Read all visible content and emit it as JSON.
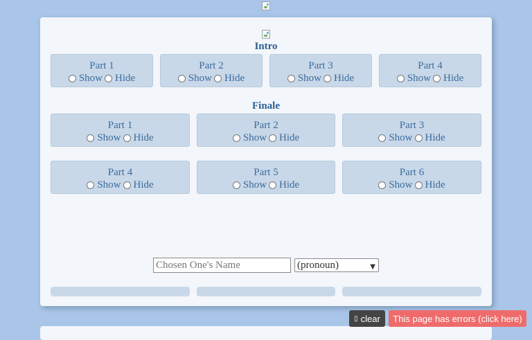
{
  "intro": {
    "title": "Intro",
    "parts": [
      {
        "label": "Part 1",
        "show": "Show",
        "hide": "Hide"
      },
      {
        "label": "Part 2",
        "show": "Show",
        "hide": "Hide"
      },
      {
        "label": "Part 3",
        "show": "Show",
        "hide": "Hide"
      },
      {
        "label": "Part 4",
        "show": "Show",
        "hide": "Hide"
      }
    ]
  },
  "finale": {
    "title": "Finale",
    "parts": [
      {
        "label": "Part 1",
        "show": "Show",
        "hide": "Hide"
      },
      {
        "label": "Part 2",
        "show": "Show",
        "hide": "Hide"
      },
      {
        "label": "Part 3",
        "show": "Show",
        "hide": "Hide"
      },
      {
        "label": "Part 4",
        "show": "Show",
        "hide": "Hide"
      },
      {
        "label": "Part 5",
        "show": "Show",
        "hide": "Hide"
      },
      {
        "label": "Part 6",
        "show": "Show",
        "hide": "Hide"
      }
    ]
  },
  "form": {
    "name_placeholder": "Chosen One's Name",
    "pronoun_selected": "(pronoun)"
  },
  "toolbar": {
    "clear_label": "clear",
    "errors_label": "This page has errors (click here)"
  },
  "colors": {
    "page_background": "#a9c6e8",
    "panel": "#f3f6fa",
    "box": "#c8d8e9",
    "heading": "#2b5f92",
    "error": "#ef6b6b"
  }
}
